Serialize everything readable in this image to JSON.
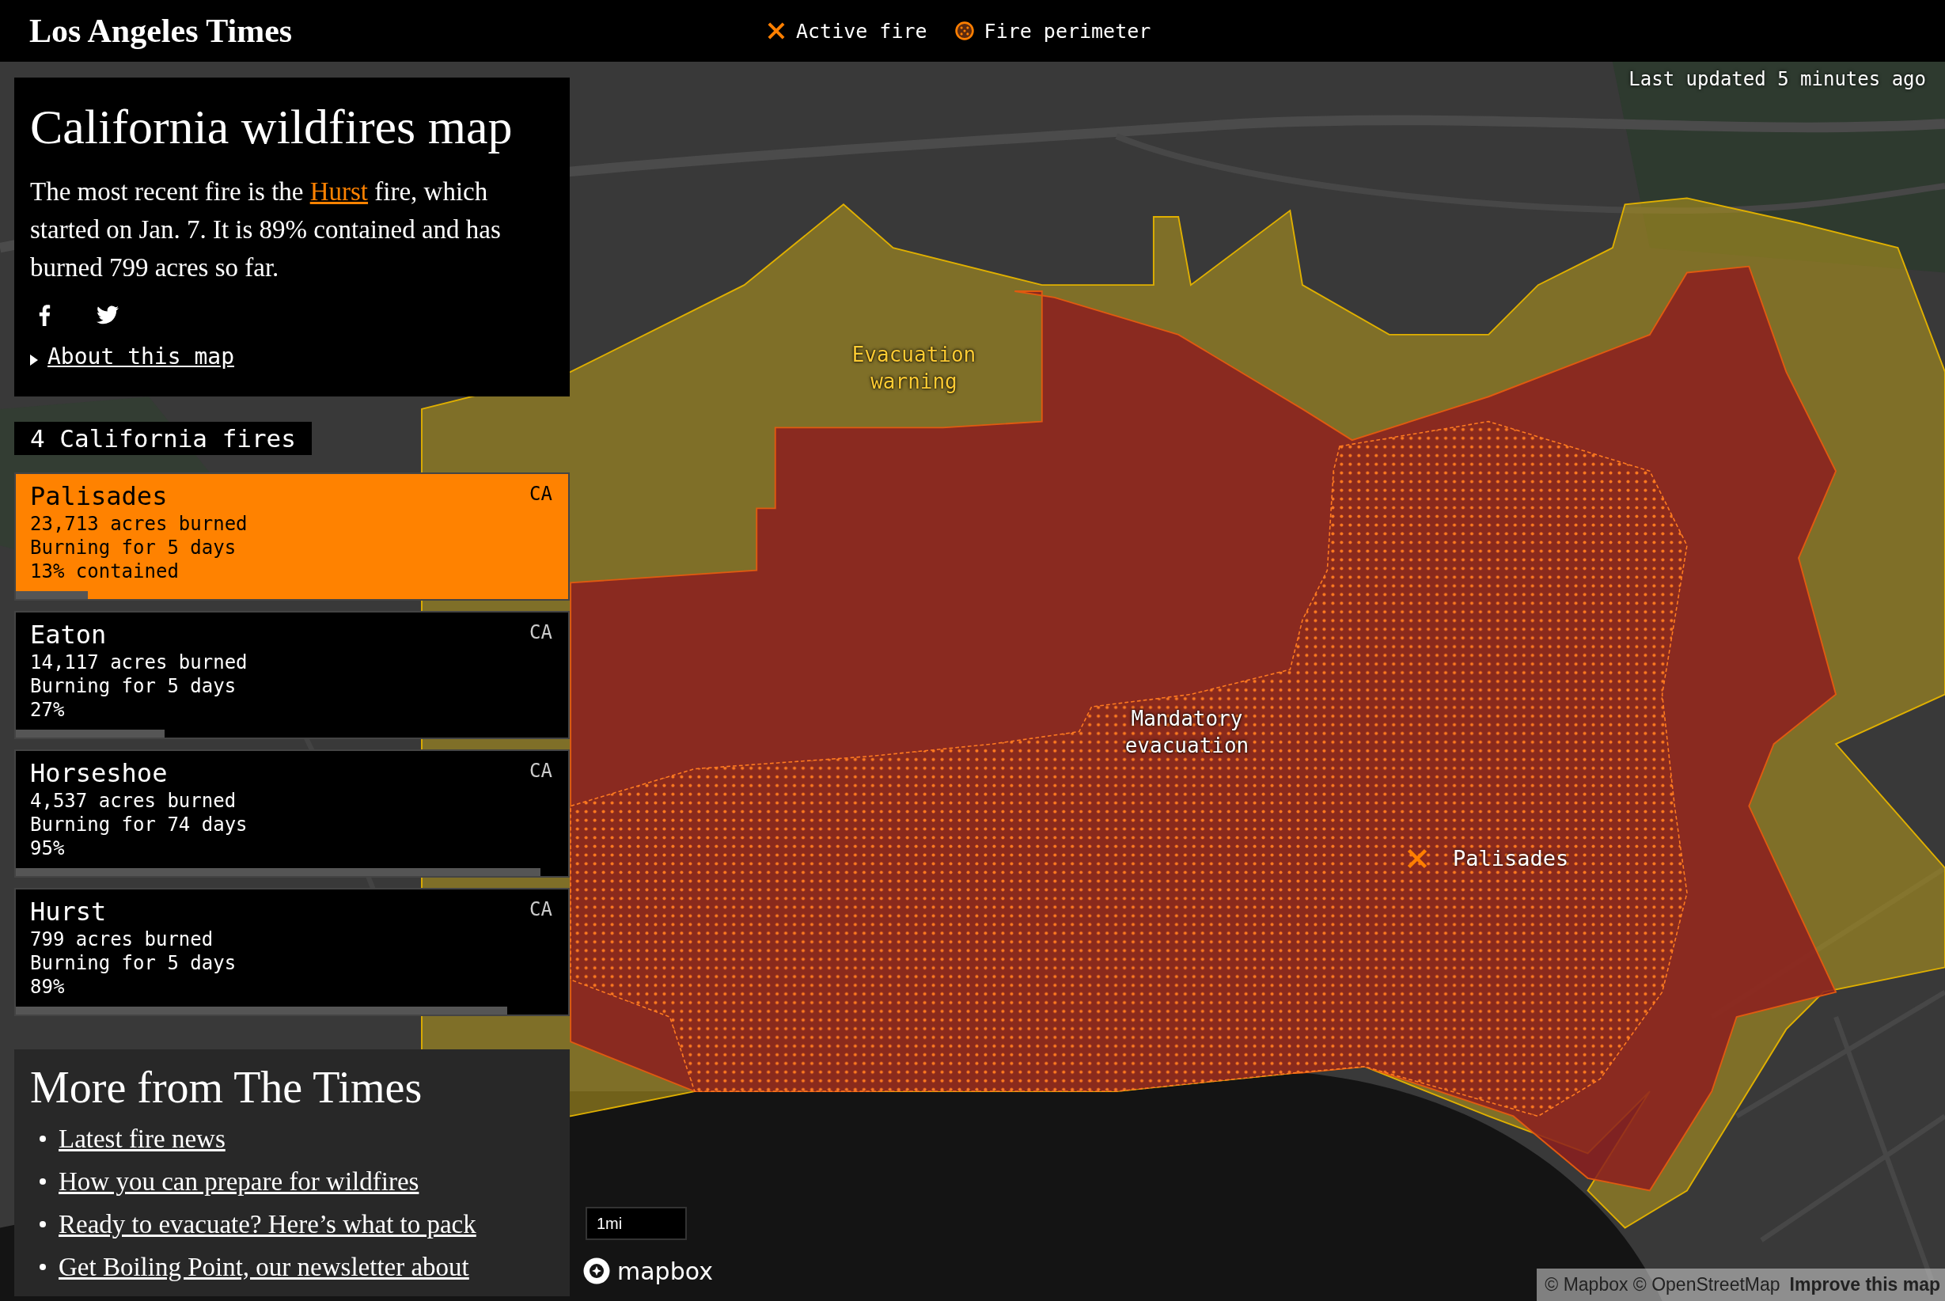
{
  "header": {
    "logo": "Los Angeles Times",
    "legend": [
      {
        "kind": "active_fire",
        "label": "Active fire"
      },
      {
        "kind": "perimeter",
        "label": "Fire perimeter"
      }
    ]
  },
  "last_updated": "Last updated 5 minutes ago",
  "intro": {
    "title": "California wildfires map",
    "summary_before": "The most recent fire is the",
    "summary_link": "Hurst",
    "summary_after": "fire, which started on Jan. 7. It is 89% contained and has burned 799 acres so far.",
    "share": [
      {
        "kind": "facebook"
      },
      {
        "kind": "twitter"
      }
    ],
    "about_link": "About this map"
  },
  "fires": {
    "count_label": "4 California fires",
    "items": [
      {
        "name": "Palisades",
        "state": "CA",
        "acres": "23,713 acres burned",
        "duration": "Burning for 5 days",
        "containment": "13% contained",
        "level": 0.13,
        "selected": true
      },
      {
        "name": "Eaton",
        "state": "CA",
        "acres": "14,117 acres burned",
        "duration": "Burning for 5 days",
        "containment": "27%",
        "level": 0.27,
        "selected": false
      },
      {
        "name": "Horseshoe",
        "state": "CA",
        "acres": "4,537 acres burned",
        "duration": "Burning for 74 days",
        "containment": "95%",
        "level": 0.95,
        "selected": false
      },
      {
        "name": "Hurst",
        "state": "CA",
        "acres": "799 acres burned",
        "duration": "Burning for 5 days",
        "containment": "89%",
        "level": 0.89,
        "selected": false
      }
    ]
  },
  "more": {
    "title": "More from The Times",
    "links": [
      "Latest fire news",
      "How you can prepare for wildfires",
      "Ready to evacuate? Here’s what to pack",
      "Get Boiling Point, our newsletter about"
    ]
  },
  "map": {
    "zones": [
      {
        "kind": "warning",
        "label": "Evacuation warning"
      },
      {
        "kind": "mandatory",
        "label": "Mandatory evacuation"
      }
    ],
    "markers": [
      {
        "label": "Palisades"
      }
    ],
    "scale": "1mi",
    "logo": "mapbox",
    "attribution": "© Mapbox © OpenStreetMap",
    "improve_link": "Improve this map"
  }
}
